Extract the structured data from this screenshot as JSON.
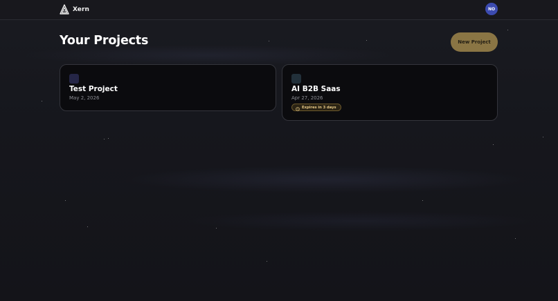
{
  "brand": {
    "name": "Xern"
  },
  "user": {
    "initials": "NO"
  },
  "page": {
    "title": "Your Projects"
  },
  "actions": {
    "new_project_label": "New Project"
  },
  "projects": [
    {
      "name": "Test Project",
      "date": "May 2, 2026",
      "color": "#252647"
    },
    {
      "name": "AI B2B Saas",
      "date": "Apr 27, 2026",
      "color": "#22303a",
      "badge": "Expires in 3 days"
    }
  ],
  "colors": {
    "accent": "#8a7544",
    "avatar": "#3c4bb0",
    "badge_text": "#e7c987",
    "background": "#16161b"
  },
  "icons": {
    "logo": "xern-logo-icon",
    "badge": "clock-icon"
  }
}
